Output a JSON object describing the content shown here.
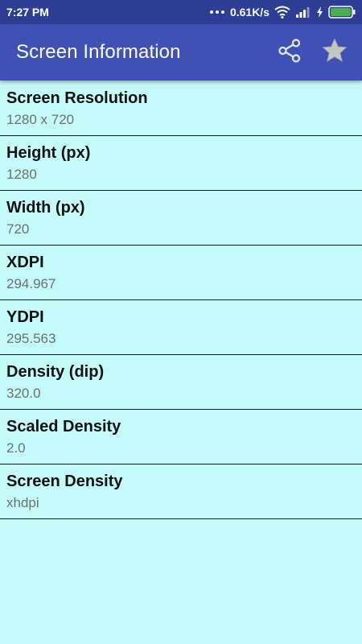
{
  "status_bar": {
    "time": "7:27 PM",
    "network_speed": "0.61K/s",
    "icons": [
      "dots-icon",
      "wifi-icon",
      "signal-icon",
      "charging-icon",
      "battery-icon"
    ],
    "battery_color": "#4caf50"
  },
  "app_bar": {
    "title": "Screen Information",
    "actions": [
      "share-icon",
      "star-icon"
    ],
    "color": "#3f51b5"
  },
  "items": [
    {
      "label": "Screen Resolution",
      "value": "1280 x 720"
    },
    {
      "label": "Height (px)",
      "value": "1280"
    },
    {
      "label": "Width (px)",
      "value": "720"
    },
    {
      "label": "XDPI",
      "value": "294.967"
    },
    {
      "label": "YDPI",
      "value": "295.563"
    },
    {
      "label": "Density (dip)",
      "value": "320.0"
    },
    {
      "label": "Scaled Density",
      "value": "2.0"
    },
    {
      "label": "Screen Density",
      "value": "xhdpi"
    }
  ],
  "background_color": "#c4fbf8"
}
